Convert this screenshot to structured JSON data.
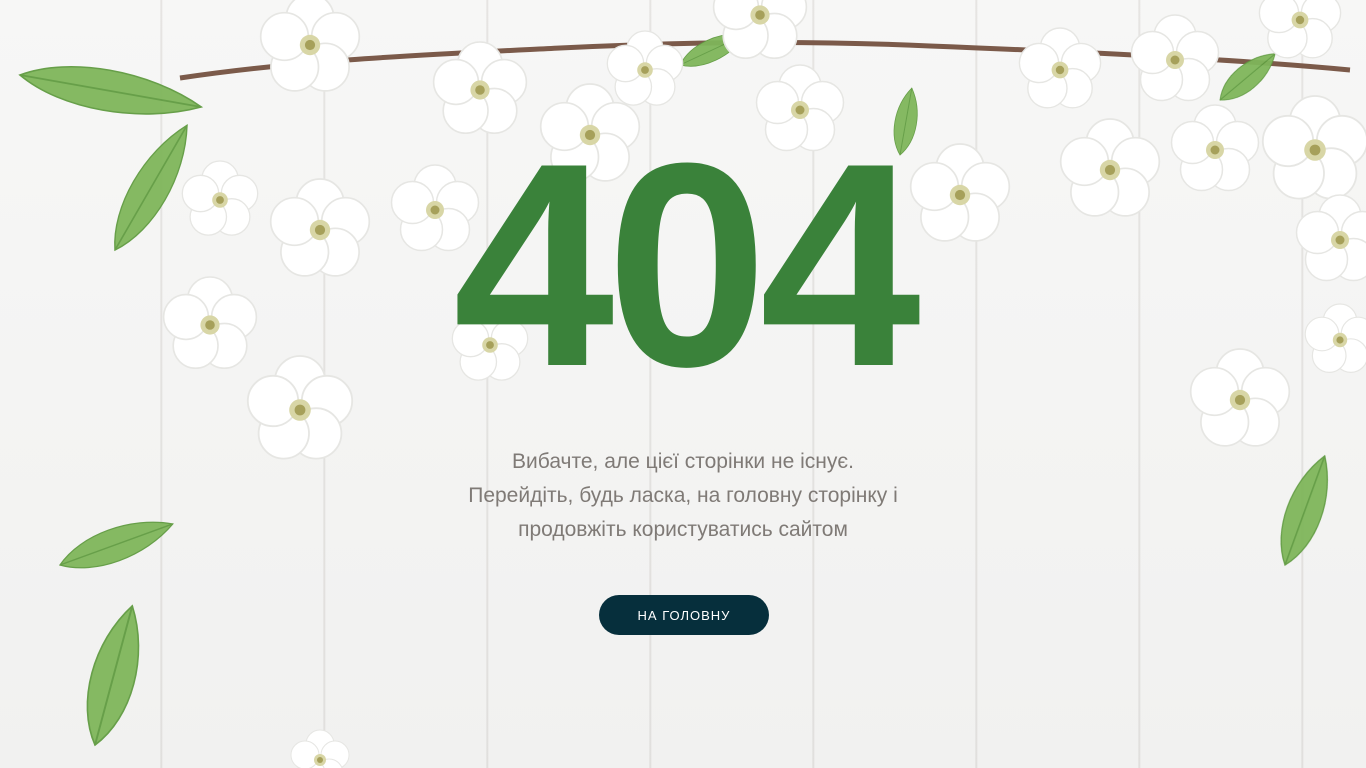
{
  "error": {
    "code": "404"
  },
  "message": {
    "line1": "Вибачте, але цієї сторінки не існує.",
    "line2": "Перейдіть, будь ласка, на головну сторінку і",
    "line3": "продовжіть користуватись сайтом"
  },
  "home_button": {
    "label": "НА ГОЛОВНУ"
  },
  "colors": {
    "code": "#3a823a",
    "message": "#7f7a76",
    "button_bg": "#062f3c",
    "button_text": "#ffffff",
    "background": "#f4f4f3"
  },
  "decor": {
    "background": "white-wooden-planks",
    "flowers": "cherry-blossom-branch",
    "leaves": "green-leaves"
  }
}
